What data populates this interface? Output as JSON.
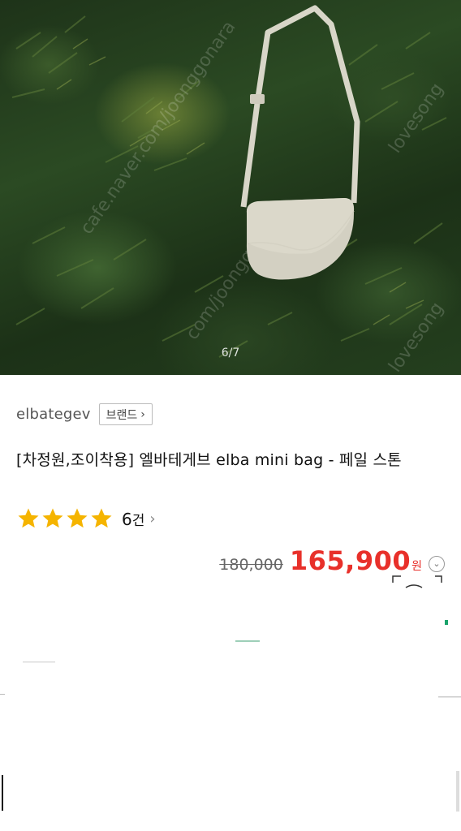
{
  "gallery": {
    "counter": "6/7",
    "watermarks": [
      "cafe.naver.com/joonggonara",
      "com/joonggonara",
      "lovesong"
    ]
  },
  "seller": {
    "name": "elbategev",
    "brand_label": "브랜드",
    "brand_chevron": "›"
  },
  "product": {
    "title": "[차정원,조이착용] 엘바테게브 elba mini bag - 페일 스톤"
  },
  "rating": {
    "stars": 4,
    "count": "6",
    "count_unit": "건",
    "chevron": "›"
  },
  "price": {
    "original": "180,000",
    "sale": "165,900",
    "currency": "원",
    "toggle_icon": "chevron-down-icon"
  },
  "colors": {
    "accent_red": "#e8302a",
    "star_yellow": "#f5b400"
  }
}
